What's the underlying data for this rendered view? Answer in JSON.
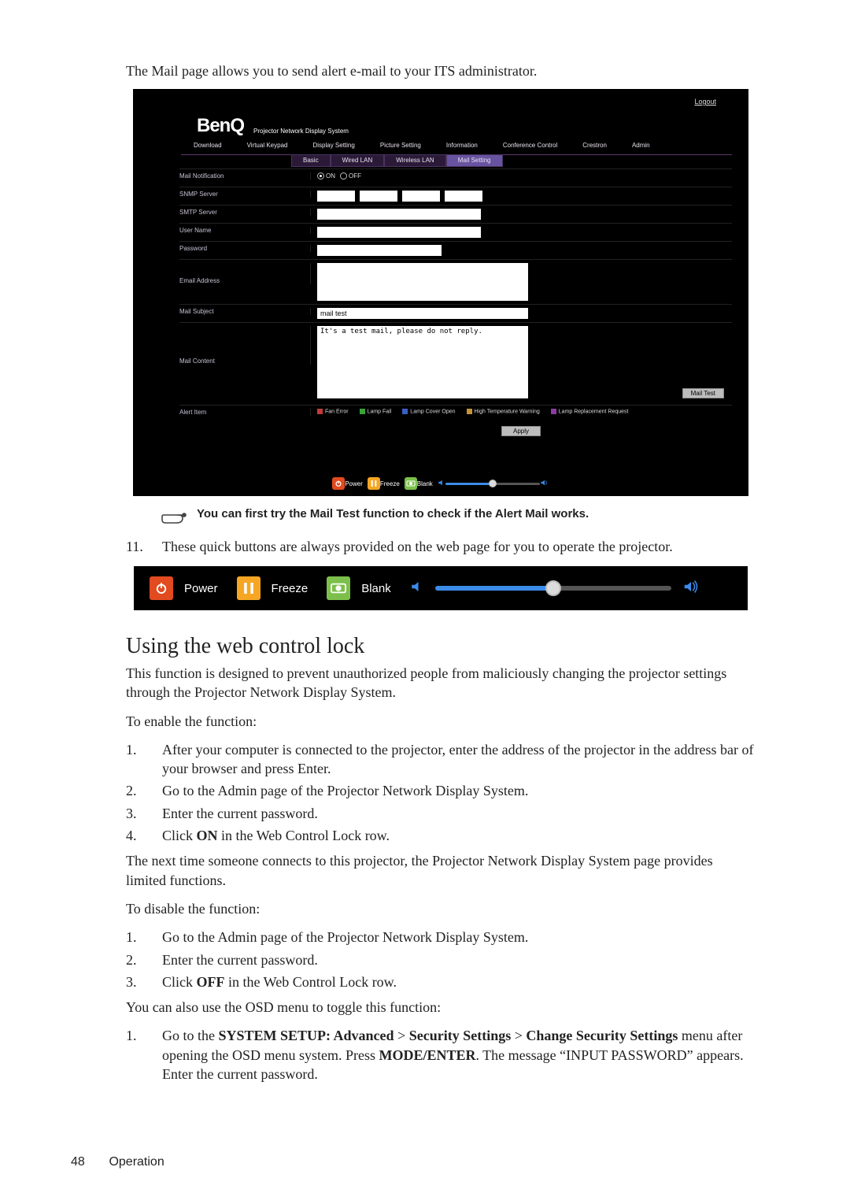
{
  "intro": "The Mail page allows you to send alert e-mail to your ITS administrator.",
  "shot": {
    "logout": "Logout",
    "brand": "BenQ",
    "brand_sub": "Projector Network Display System",
    "top_tabs": [
      "Download",
      "Virtual Keypad",
      "Display Setting",
      "Picture Setting",
      "Information",
      "Conference Control",
      "Crestron",
      "Admin"
    ],
    "sub_tabs": [
      "Basic",
      "Wired LAN",
      "Wireless LAN",
      "Mail Setting"
    ],
    "fields": {
      "mail_notification": "Mail Notification",
      "snmp": "SNMP Server",
      "smtp": "SMTP Server",
      "user": "User Name",
      "pass": "Password",
      "email": "Email Address",
      "subject_lbl": "Mail Subject",
      "subject_val": "mail test",
      "content_lbl": "Mail Content",
      "content_val": "It's a test mail, please do not reply.",
      "alert_item": "Alert Item"
    },
    "on": "ON",
    "off": "OFF",
    "mail_test_btn": "Mail Test",
    "apply_btn": "Apply",
    "alert_items": [
      {
        "label": "Fan Error",
        "color": "#c23a3a"
      },
      {
        "label": "Lamp Fail",
        "color": "#3aa23a"
      },
      {
        "label": "Lamp Cover Open",
        "color": "#3a5fc2"
      },
      {
        "label": "High Temperature Warning",
        "color": "#c2943a"
      },
      {
        "label": "Lamp Replacement Request",
        "color": "#8b3aa2"
      }
    ]
  },
  "tip": "You can first try the Mail Test function to check if the Alert Mail works.",
  "item11_num": "11.",
  "item11_text": "These quick buttons are always provided on the web page for you to operate the projector.",
  "quick": {
    "power": "Power",
    "freeze": "Freeze",
    "blank": "Blank"
  },
  "section": "Using the web control lock",
  "p1": "This function is designed to prevent unauthorized people from maliciously changing the projector settings through the Projector Network Display System.",
  "p2": "To enable the function:",
  "enable_steps": [
    "After your computer is connected to the projector, enter the address of the projector in the address bar of your browser and press Enter.",
    "Go to the Admin page of the Projector Network Display System.",
    "Enter the current password.",
    "Click <b>ON</b> in the Web Control Lock row."
  ],
  "p3": "The next time someone connects to this projector, the Projector Network Display System page provides limited functions.",
  "p4": "To disable the function:",
  "disable_steps": [
    "Go to the Admin page of the Projector Network Display System.",
    "Enter the current password.",
    "Click <b>OFF</b> in the Web Control Lock row."
  ],
  "p5": "You can also use the OSD menu to toggle this function:",
  "osd_steps": [
    "Go to the <b>SYSTEM SETUP: Advanced</b> &gt; <b>Security Settings</b> &gt; <b>Change Security Settings</b> menu after opening the OSD menu system. Press <b>MODE/ENTER</b>. The message “INPUT PASSWORD” appears. Enter the current password."
  ],
  "footer_page": "48",
  "footer_section": "Operation"
}
